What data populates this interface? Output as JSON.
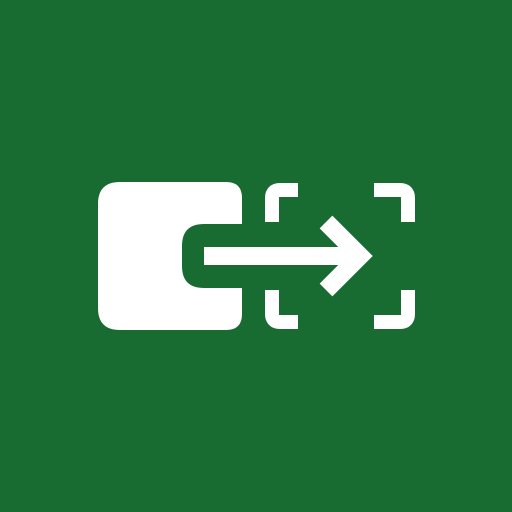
{
  "icon": {
    "name": "move-to-frame-icon",
    "background_color": "#186C32",
    "glyph_color": "#FFFFFF"
  }
}
